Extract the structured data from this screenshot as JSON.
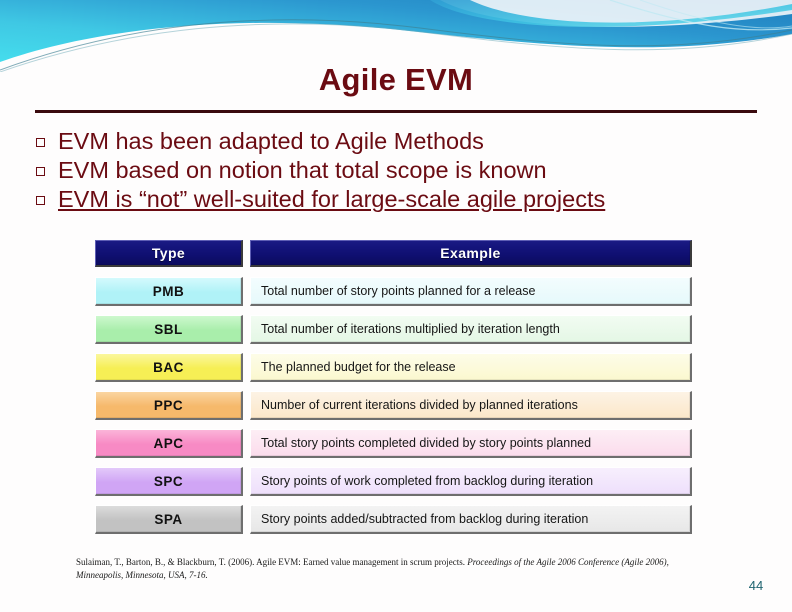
{
  "slide": {
    "title": "Agile EVM",
    "page_number": "44",
    "accent_color": "#6b0b12",
    "banner_color_start": "#7ee8ef",
    "banner_color_end": "#1a7fc1",
    "header_cell_color": "#101072",
    "page_number_color": "#1f6470"
  },
  "bullets": [
    {
      "marker": "hollow-square",
      "text": "EVM has been adapted to Agile Methods",
      "underlined": false
    },
    {
      "marker": "hollow-square",
      "text": "EVM based on notion that total scope is known",
      "underlined": false
    },
    {
      "marker": "hollow-square",
      "text": "EVM is “not” well-suited for large-scale agile projects",
      "underlined": true
    }
  ],
  "table": {
    "columns": [
      "Type",
      "Example"
    ],
    "rows": [
      {
        "type": "PMB",
        "example": "Total number of story points planned for a release",
        "type_bg": "#b0f2f7",
        "type_bg_top": "#d4fafd",
        "example_bg": "#e6f9fb",
        "example_bg_top": "#f3fdfe"
      },
      {
        "type": "SBL",
        "example": "Total number of iterations multiplied by iteration length",
        "type_bg": "#a9eeab",
        "type_bg_top": "#cdf8ce",
        "example_bg": "#e4f7e5",
        "example_bg_top": "#f2fcf2"
      },
      {
        "type": "BAC",
        "example": "The planned budget for the release",
        "type_bg": "#f6ef55",
        "type_bg_top": "#fbf79e",
        "example_bg": "#fbf8cf",
        "example_bg_top": "#fdfce8"
      },
      {
        "type": "PPC",
        "example": "Number of current iterations divided by planned iterations",
        "type_bg": "#f6b96b",
        "type_bg_top": "#fad5a1",
        "example_bg": "#fbe7c9",
        "example_bg_top": "#fdf3e5"
      },
      {
        "type": "APC",
        "example": "Total story points completed divided by story points planned",
        "type_bg": "#f78ac4",
        "type_bg_top": "#fbb4d9",
        "example_bg": "#fbdcec",
        "example_bg_top": "#fdeef5"
      },
      {
        "type": "SPC",
        "example": "Story points of work completed from backlog during iteration",
        "type_bg": "#d0a5f5",
        "type_bg_top": "#e3c9fa",
        "example_bg": "#eedffb",
        "example_bg_top": "#f7effd"
      },
      {
        "type": "SPA",
        "example": "Story points added/subtracted from backlog during iteration",
        "type_bg": "#c2c2c2",
        "type_bg_top": "#dcdcdc",
        "example_bg": "#e7e7e7",
        "example_bg_top": "#f3f3f3"
      }
    ]
  },
  "citation": {
    "part1": "Sulaiman, T., Barton, B., & Blackburn, T. (2006). Agile EVM: Earned value management in scrum projects. ",
    "part2_italic": "Proceedings of the Agile 2006 Conference (Agile 2006), Minneapolis, Minnesota, USA, 7-16."
  }
}
